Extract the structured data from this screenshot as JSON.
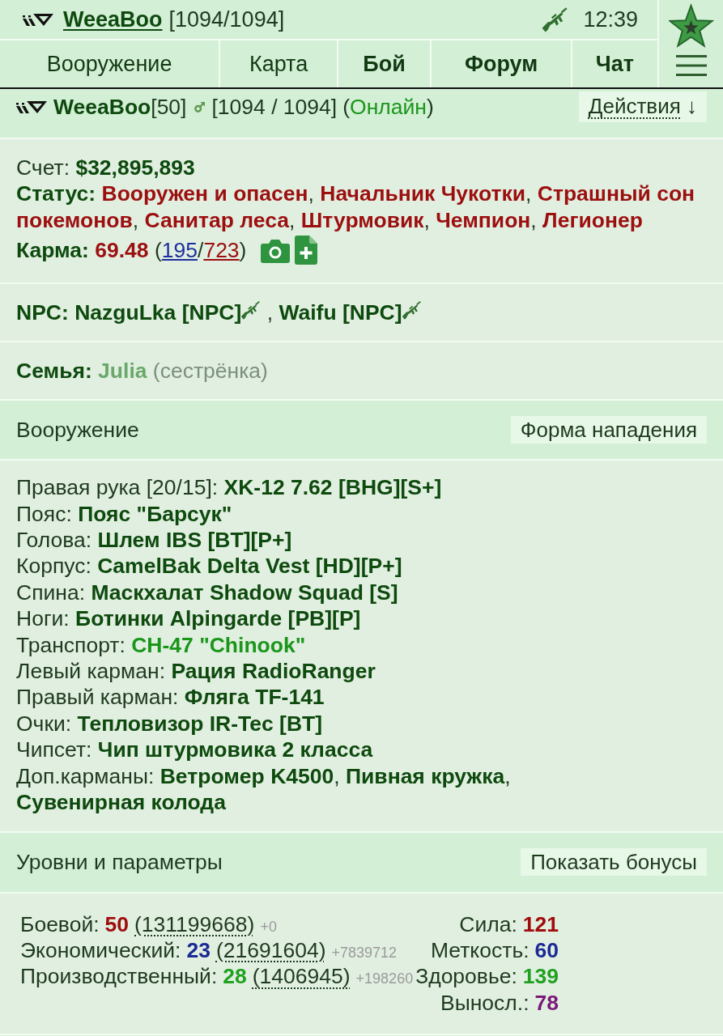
{
  "top_bar": {
    "user_name": "WeeaBoo",
    "health": "[1094/1094]",
    "time": "12:39"
  },
  "nav_tabs": [
    {
      "label": "Вооружение",
      "highlighted": false
    },
    {
      "label": "Карта",
      "highlighted": false
    },
    {
      "label": "Бой",
      "highlighted": true
    },
    {
      "label": "Форум",
      "highlighted": true
    },
    {
      "label": "Чат",
      "highlighted": true
    }
  ],
  "profile": {
    "name": "WeeaBoo",
    "level": "[50]",
    "health": "[1094 / 1094]",
    "presence": {
      "open": "(",
      "value": "Онлайн",
      "close": ")"
    },
    "actions_button": {
      "label": "Действия",
      "arrow": "↓"
    }
  },
  "summary": {
    "account": {
      "label": "Счет:",
      "value": "$32,895,893"
    },
    "status": {
      "label": "Статус:",
      "separator": ",",
      "titles": [
        "Вооружен и опасен",
        "Начальник Чукотки",
        "Страшный сон покемонов",
        "Санитар леса",
        "Штурмовик",
        "Чемпион",
        "Легионер"
      ]
    },
    "karma": {
      "label": "Карма:",
      "value": "69.48",
      "open": "(",
      "positive": "195",
      "divider": "/",
      "negative": "723",
      "close": ")"
    }
  },
  "npc": {
    "label": "NPC:",
    "separator": ",",
    "characters": [
      "NazguLka [NPC]",
      "Waifu [NPC]"
    ]
  },
  "family": {
    "label": "Семья:",
    "members": [
      {
        "name": "Julia",
        "relation": "(сестрёнка)"
      }
    ]
  },
  "equipment": {
    "title": "Вооружение",
    "button": "Форма нападения",
    "separator": ",",
    "slots": [
      {
        "slot": "Правая рука [20/15]:",
        "items": [
          {
            "name": "XK-12 7.62 [BHG][S+]",
            "kind": "regular"
          }
        ]
      },
      {
        "slot": "Пояс:",
        "items": [
          {
            "name": "Пояс \"Барсук\"",
            "kind": "regular"
          }
        ]
      },
      {
        "slot": "Голова:",
        "items": [
          {
            "name": "Шлем IBS [BT][P+]",
            "kind": "regular"
          }
        ]
      },
      {
        "slot": "Корпус:",
        "items": [
          {
            "name": "CamelBak Delta Vest [HD][P+]",
            "kind": "regular"
          }
        ]
      },
      {
        "slot": "Спина:",
        "items": [
          {
            "name": "Маскхалат Shadow Squad [S]",
            "kind": "regular"
          }
        ]
      },
      {
        "slot": "Ноги:",
        "items": [
          {
            "name": "Ботинки Alpingarde [PB][P]",
            "kind": "regular"
          }
        ]
      },
      {
        "slot": "Транспорт:",
        "items": [
          {
            "name": "CH-47 \"Chinook\"",
            "kind": "special"
          }
        ]
      },
      {
        "slot": "Левый карман:",
        "items": [
          {
            "name": "Рация RadioRanger",
            "kind": "regular"
          }
        ]
      },
      {
        "slot": "Правый карман:",
        "items": [
          {
            "name": "Фляга TF-141",
            "kind": "regular"
          }
        ]
      },
      {
        "slot": "Очки:",
        "items": [
          {
            "name": "Тепловизор IR-Tec [BT]",
            "kind": "regular"
          }
        ]
      },
      {
        "slot": "Чипсет:",
        "items": [
          {
            "name": "Чип штурмовика 2 класса",
            "kind": "regular"
          }
        ]
      },
      {
        "slot": "Доп.карманы:",
        "items": [
          {
            "name": "Ветромер K4500",
            "kind": "regular"
          },
          {
            "name": "Пивная кружка",
            "kind": "regular"
          },
          {
            "name": "Сувенирная колода",
            "kind": "regular"
          }
        ]
      }
    ]
  },
  "levels": {
    "title": "Уровни и параметры",
    "button": "Показать бонусы",
    "skills": [
      {
        "name": "Боевой:",
        "level": "50",
        "experience": "(131199668)",
        "gain": "+0",
        "color": "#a00d0d"
      },
      {
        "name": "Экономический:",
        "level": "23",
        "experience": "(21691604)",
        "gain": "+7839712",
        "color": "#1b2a94"
      },
      {
        "name": "Производственный:",
        "level": "28",
        "experience": "(1406945)",
        "gain": "+198260",
        "color": "#21a021"
      }
    ],
    "stats": [
      {
        "name": "Сила:",
        "value": "121",
        "color": "#a00d0d"
      },
      {
        "name": "Меткость:",
        "value": "60",
        "color": "#1b2a94"
      },
      {
        "name": "Здоровье:",
        "value": "139",
        "color": "#21a021"
      },
      {
        "name": "Выносл.:",
        "value": "78",
        "color": "#7a1a7a"
      }
    ]
  }
}
